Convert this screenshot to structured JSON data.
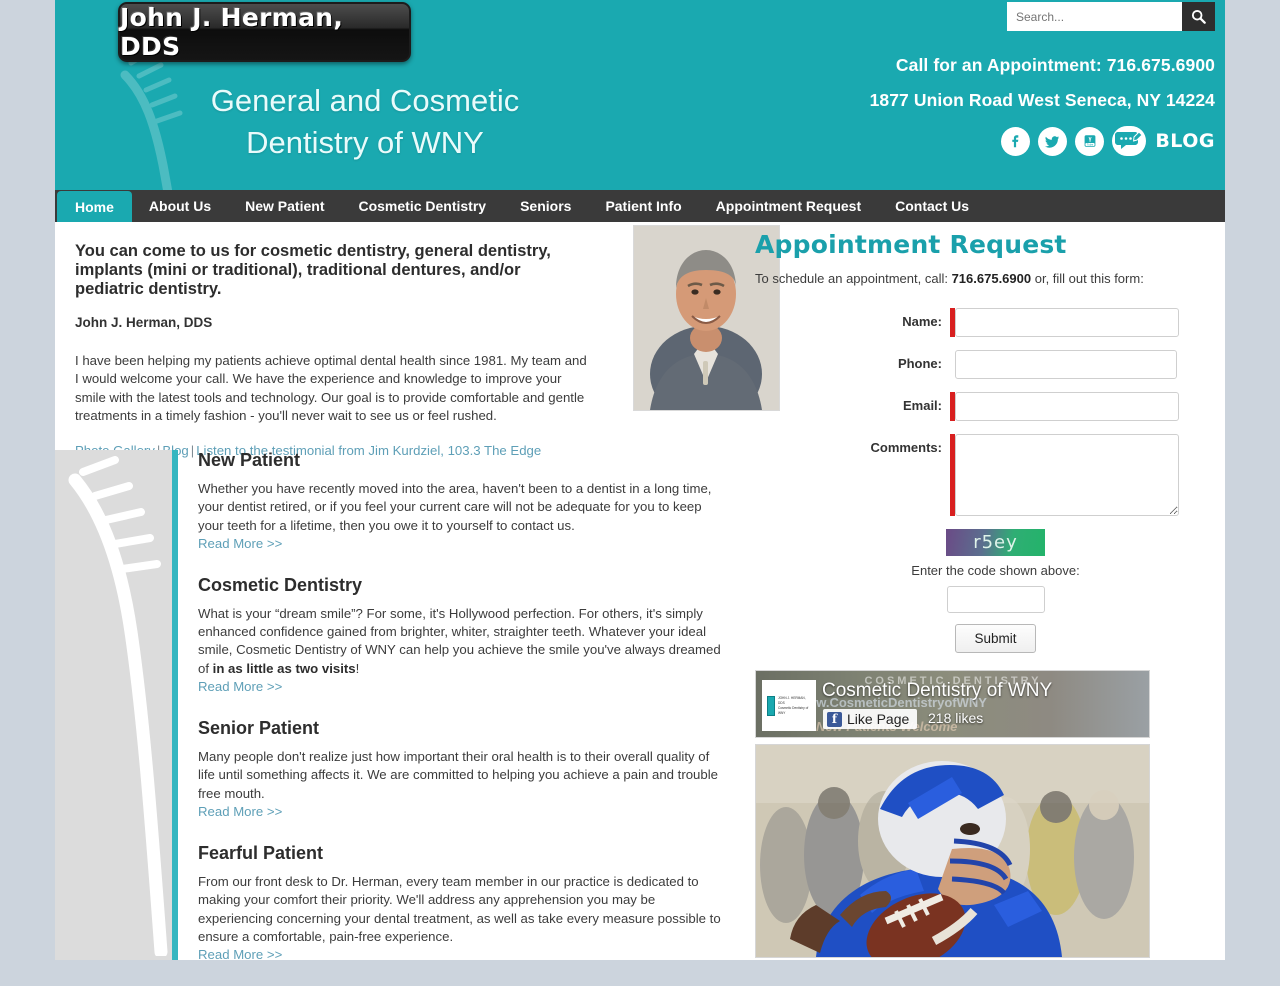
{
  "header": {
    "logo_text": "John J. Herman, DDS",
    "tagline_line1": "General and Cosmetic",
    "tagline_line2": "Dentistry of WNY",
    "search_placeholder": "Search...",
    "search_value": "",
    "phone_line": "Call for an Appointment: 716.675.6900",
    "address_line": "1877 Union Road West Seneca, NY 14224",
    "blog_label": "BLOG",
    "social": [
      {
        "name": "facebook-icon",
        "label": "Facebook"
      },
      {
        "name": "twitter-icon",
        "label": "Twitter"
      },
      {
        "name": "youtube-icon",
        "label": "YouTube"
      },
      {
        "name": "blog-icon",
        "label": "Blog"
      }
    ],
    "brand_teal": "#1aa9b0"
  },
  "nav": {
    "items": [
      {
        "label": "Home",
        "active": true
      },
      {
        "label": "About Us",
        "active": false
      },
      {
        "label": "New Patient",
        "active": false
      },
      {
        "label": "Cosmetic Dentistry",
        "active": false
      },
      {
        "label": "Seniors",
        "active": false
      },
      {
        "label": "Patient Info",
        "active": false
      },
      {
        "label": "Appointment Request",
        "active": false
      },
      {
        "label": "Contact Us",
        "active": false
      }
    ]
  },
  "intro": {
    "heading": "You can come to us for cosmetic dentistry, general dentistry, implants (mini or traditional), traditional dentures, and/or pediatric dentistry.",
    "byline": "John J. Herman, DDS",
    "body": "I have been helping my patients achieve optimal dental health since 1981. My team and I would welcome your call.  We have the experience and knowledge to improve your smile with the latest tools and technology.  Our goal is to provide comfortable and gentle treatments in a timely fashion - you'll never wait to see us or feel rushed.",
    "link_photo_gallery": "Photo Gallery",
    "link_blog": "Blog",
    "link_testimonial": "Listen to the testimonial from Jim Kurdziel, 103.3 The Edge",
    "separator": "|"
  },
  "sections": [
    {
      "title": "New Patient",
      "body": "Whether you have recently moved into the area, haven't been to a dentist in a long time, your dentist retired, or if you feel your current care will not be adequate for you to keep your teeth for a lifetime, then you owe it to yourself to contact us.",
      "more": "Read More >>"
    },
    {
      "title": "Cosmetic Dentistry",
      "body_pre": "What is your “dream smile”?  For some, it's Hollywood perfection.  For others, it's simply enhanced confidence gained from brighter, whiter, straighter teeth.  Whatever your ideal smile, Cosmetic Dentistry of WNY can help you achieve the smile you've always dreamed of ",
      "body_bold": "in as little as two visits",
      "body_post": "!",
      "more": "Read More >>"
    },
    {
      "title": "Senior Patient",
      "body": "Many people don't realize just how important their oral health is to their overall quality of life until something affects it.  We are committed to helping you achieve a pain and trouble free mouth.",
      "more": "Read More >>"
    },
    {
      "title": "Fearful Patient",
      "body": "From our front desk to Dr. Herman, every team member in our practice is dedicated to making your comfort their priority.  We'll address any apprehension you may be experiencing concerning your dental treatment, as well as take every measure possible to ensure a comfortable, pain-free experience.",
      "more": "Read More >>"
    }
  ],
  "appointment": {
    "title": "Appointment Request",
    "subtitle_pre": "To schedule an appointment, call: ",
    "subtitle_phone": "716.675.6900",
    "subtitle_post": " or, fill out this form:",
    "fields": [
      {
        "label": "Name:",
        "value": "",
        "required": true,
        "type": "text"
      },
      {
        "label": "Phone:",
        "value": "",
        "required": false,
        "type": "text"
      },
      {
        "label": "Email:",
        "value": "",
        "required": true,
        "type": "text"
      },
      {
        "label": "Comments:",
        "value": "",
        "required": true,
        "type": "textarea"
      }
    ],
    "captcha_code": "r5ey",
    "captcha_label": "Enter the code shown above:",
    "captcha_value": "",
    "submit_label": "Submit",
    "required_color": "#d81f1f",
    "title_color": "#1aa0ab"
  },
  "facebook": {
    "page_name": "Cosmetic Dentistry of WNY",
    "like_label": "Like Page",
    "likes_count": "218 likes",
    "cover_line1": "COSMETIC DENTISTRY",
    "cover_line2": "www.CosmeticDentistryofWNY",
    "cover_line3": "New Patients Welcome",
    "avatar_line1": "JOHN J. HERMAN, DDS",
    "avatar_line2": "Cosmetic Dentistry of WNY"
  },
  "football_photo": {
    "alt": "Football quarterback in blue uniform"
  }
}
